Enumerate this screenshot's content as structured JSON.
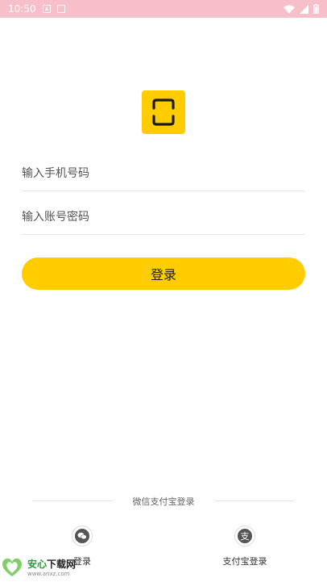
{
  "status_bar": {
    "time": "10:50",
    "icons": [
      "a-notification-icon",
      "sim-card-icon",
      "wifi-icon",
      "signal-icon",
      "battery-icon"
    ]
  },
  "app_logo": {
    "icon": "scan-frame-icon",
    "color": "#ffcc00"
  },
  "form": {
    "phone_placeholder": "输入手机号码",
    "password_placeholder": "输入账号密码",
    "login_label": "登录"
  },
  "third_party": {
    "divider_text": "微信支付宝登录",
    "wechat_label": "登录",
    "alipay_label": "支付宝登录",
    "alipay_glyph": "支"
  },
  "watermark": {
    "title_prefix": "安心",
    "title_suffix": "下载网",
    "url": "www.anxz.com"
  },
  "colors": {
    "accent": "#ffcc00",
    "status_bar": "#f7c0c8",
    "divider": "#e2e2e2"
  }
}
